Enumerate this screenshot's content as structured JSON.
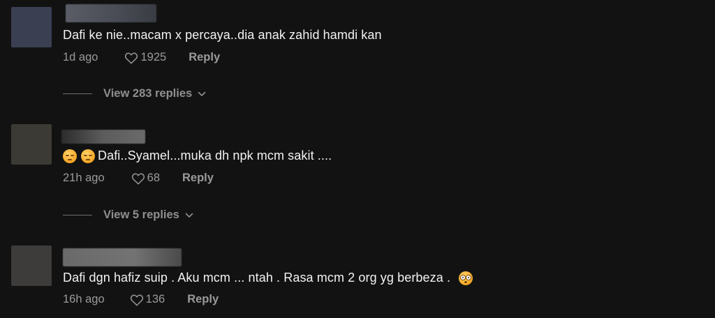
{
  "comments": [
    {
      "text": "Dafi ke nie..macam x percaya..dia anak zahid hamdi kan",
      "time": "1d ago",
      "likes": "1925",
      "reply_label": "Reply",
      "view_replies": "View 283 replies",
      "avatar_color": "#3a3f52"
    },
    {
      "emojis": [
        "relieved-face",
        "relieved-face"
      ],
      "text": "Dafi..Syamel...muka dh npk mcm sakit ....",
      "time": "21h ago",
      "likes": "68",
      "reply_label": "Reply",
      "view_replies": "View 5 replies",
      "avatar_color": "#3c3a34"
    },
    {
      "text": "Dafi dgn hafiz suip . Aku mcm ... ntah . Rasa mcm 2 org yg berbeza .",
      "trailing_emoji": "flushed-face",
      "time": "16h ago",
      "likes": "136",
      "reply_label": "Reply",
      "avatar_color": "#3d3c3a"
    }
  ],
  "colors": {
    "background": "#121212",
    "text_primary": "#f2f2f2",
    "text_secondary": "#9a9a9a"
  },
  "icons": {
    "like": "heart-outline-icon",
    "expand": "chevron-down-icon"
  }
}
